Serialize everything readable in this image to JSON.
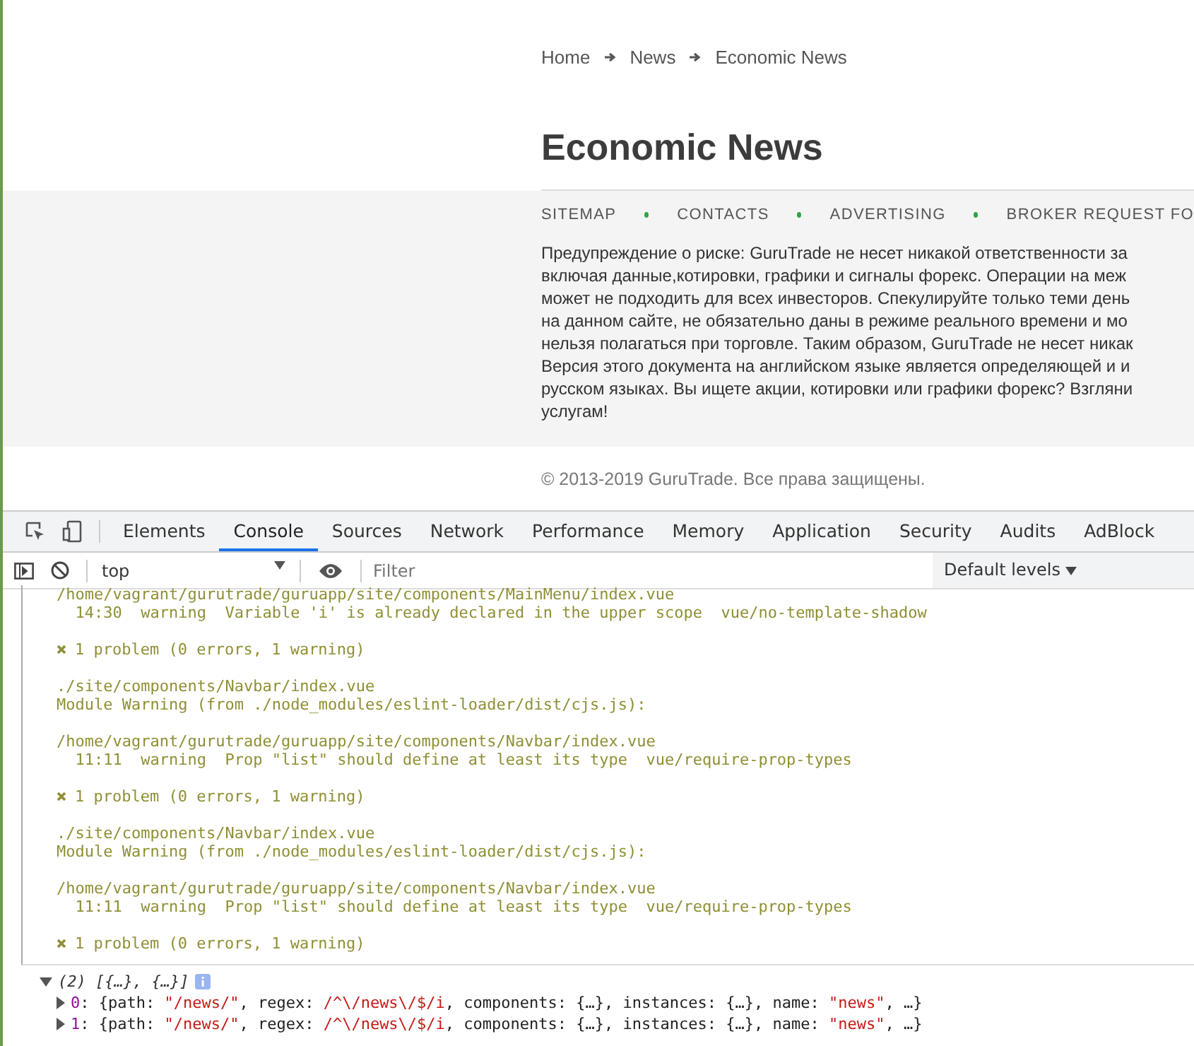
{
  "breadcrumbs": [
    "Home",
    "News",
    "Economic News"
  ],
  "heading": "Economic News",
  "footer_nav": [
    "SITEMAP",
    "CONTACTS",
    "ADVERTISING",
    "BROKER REQUEST FO"
  ],
  "disclaimer_lines": [
    "Предупреждение о риске: GuruTrade не несет никакой ответственности за",
    "включая данные,котировки, графики и сигналы форекс. Операции на меж",
    "может не подходить для всех инвесторов. Спекулируйте только теми день",
    "на данном сайте, не обязательно даны в режиме реального времени и мо",
    "нельзя полагаться при торговле. Таким образом, GuruTrade не несет никак",
    "Версия этого документа на английском языке является определяющей и и",
    "русском языках. Вы ищете акции, котировки или графики форекс? Взгляни",
    "услугам!"
  ],
  "copyright": "© 2013-2019 GuruTrade. Все права защищены.",
  "devtools": {
    "tabs": [
      {
        "label": "Elements",
        "selected": false
      },
      {
        "label": "Console",
        "selected": true
      },
      {
        "label": "Sources",
        "selected": false
      },
      {
        "label": "Network",
        "selected": false
      },
      {
        "label": "Performance",
        "selected": false
      },
      {
        "label": "Memory",
        "selected": false
      },
      {
        "label": "Application",
        "selected": false
      },
      {
        "label": "Security",
        "selected": false
      },
      {
        "label": "Audits",
        "selected": false
      },
      {
        "label": "AdBlock",
        "selected": false
      }
    ],
    "context": "top",
    "filter_placeholder": "Filter",
    "levels": "Default levels",
    "warning_paragraphs": [
      {
        "kind": "text",
        "lines": [
          "/home/vagrant/gurutrade/guruapp/site/components/MainMenu/index.vue",
          "  14:30  warning  Variable 'i' is already declared in the upper scope  vue/no-template-shadow"
        ]
      },
      {
        "kind": "problem",
        "lines": [
          "1 problem (0 errors, 1 warning)"
        ]
      },
      {
        "kind": "text",
        "lines": [
          "./site/components/Navbar/index.vue",
          "Module Warning (from ./node_modules/eslint-loader/dist/cjs.js):"
        ]
      },
      {
        "kind": "text",
        "lines": [
          "/home/vagrant/gurutrade/guruapp/site/components/Navbar/index.vue",
          "  11:11  warning  Prop \"list\" should define at least its type  vue/require-prop-types"
        ]
      },
      {
        "kind": "problem",
        "lines": [
          "1 problem (0 errors, 1 warning)"
        ]
      },
      {
        "kind": "text",
        "lines": [
          "./site/components/Navbar/index.vue",
          "Module Warning (from ./node_modules/eslint-loader/dist/cjs.js):"
        ]
      },
      {
        "kind": "text",
        "lines": [
          "/home/vagrant/gurutrade/guruapp/site/components/Navbar/index.vue",
          "  11:11  warning  Prop \"list\" should define at least its type  vue/require-prop-types"
        ]
      },
      {
        "kind": "problem",
        "lines": [
          "1 problem (0 errors, 1 warning)"
        ]
      }
    ],
    "log": {
      "summary": "(2) [{…}, {…}]",
      "expanded": true,
      "entries": [
        {
          "index": "0",
          "segments": [
            {
              "kind": "plain",
              "text": ": {path: "
            },
            {
              "kind": "string",
              "text": "\"/news/\""
            },
            {
              "kind": "plain",
              "text": ", regex: "
            },
            {
              "kind": "string",
              "text": "/^\\/news\\/$/i"
            },
            {
              "kind": "plain",
              "text": ", components: {…}, instances: {…}, name: "
            },
            {
              "kind": "string",
              "text": "\"news\""
            },
            {
              "kind": "plain",
              "text": ", …}"
            }
          ]
        },
        {
          "index": "1",
          "segments": [
            {
              "kind": "plain",
              "text": ": {path: "
            },
            {
              "kind": "string",
              "text": "\"/news/\""
            },
            {
              "kind": "plain",
              "text": ", regex: "
            },
            {
              "kind": "string",
              "text": "/^\\/news\\/$/i"
            },
            {
              "kind": "plain",
              "text": ", components: {…}, instances: {…}, name: "
            },
            {
              "kind": "string",
              "text": "\"news\""
            },
            {
              "kind": "plain",
              "text": ", …}"
            }
          ]
        }
      ]
    }
  }
}
